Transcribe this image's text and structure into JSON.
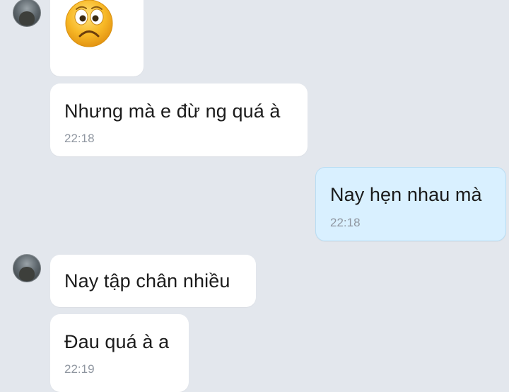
{
  "chat": {
    "messages": [
      {
        "sender": "other",
        "type": "sticker",
        "icon": "sad-face-emoji-icon"
      },
      {
        "sender": "other",
        "text": "Nhưng mà e đừ ng quá à",
        "time": "22:18"
      },
      {
        "sender": "me",
        "text": "Nay hẹn nhau mà",
        "time": "22:18"
      },
      {
        "sender": "other",
        "text": "Nay tập chân nhiều"
      },
      {
        "sender": "other",
        "text": "Đau quá à a",
        "time": "22:19"
      }
    ]
  },
  "colors": {
    "background": "#e3e7ed",
    "incoming_bubble": "#ffffff",
    "outgoing_bubble": "#d9f0ff",
    "timestamp": "#8f96a0"
  }
}
